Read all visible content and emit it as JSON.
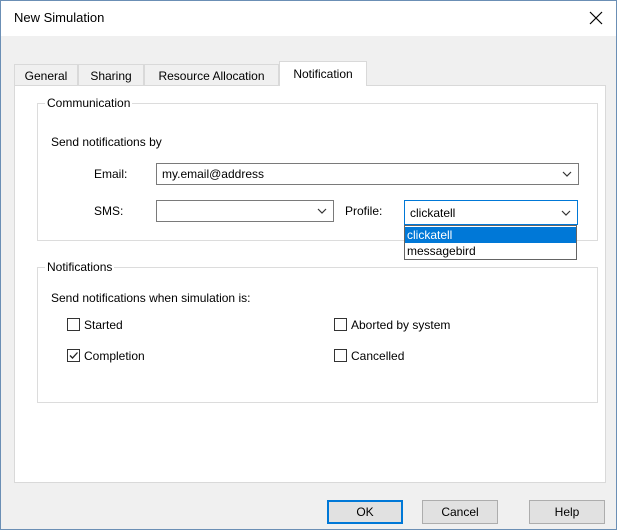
{
  "window": {
    "title": "New Simulation"
  },
  "tabs": [
    {
      "label": "General"
    },
    {
      "label": "Sharing"
    },
    {
      "label": "Resource Allocation"
    },
    {
      "label": "Notification",
      "active": true
    }
  ],
  "communication": {
    "legend": "Communication",
    "intro": "Send notifications by",
    "email_label": "Email:",
    "email_value": "my.email@address",
    "sms_label": "SMS:",
    "sms_value": "",
    "profile_label": "Profile:",
    "profile_value": "clickatell",
    "profile_options": [
      "clickatell",
      "messagebird"
    ]
  },
  "notifications": {
    "legend": "Notifications",
    "intro": "Send notifications when simulation is:",
    "options": [
      {
        "label": "Started",
        "checked": false
      },
      {
        "label": "Aborted by system",
        "checked": false
      },
      {
        "label": "Completion",
        "checked": true
      },
      {
        "label": "Cancelled",
        "checked": false
      }
    ]
  },
  "buttons": {
    "ok": "OK",
    "cancel": "Cancel",
    "help": "Help"
  },
  "colors": {
    "accent": "#0078d7",
    "selection_text": "#ffffff"
  },
  "icons": {
    "close": "close-icon",
    "dropdown": "chevron-down-icon",
    "check": "checkmark-icon"
  }
}
